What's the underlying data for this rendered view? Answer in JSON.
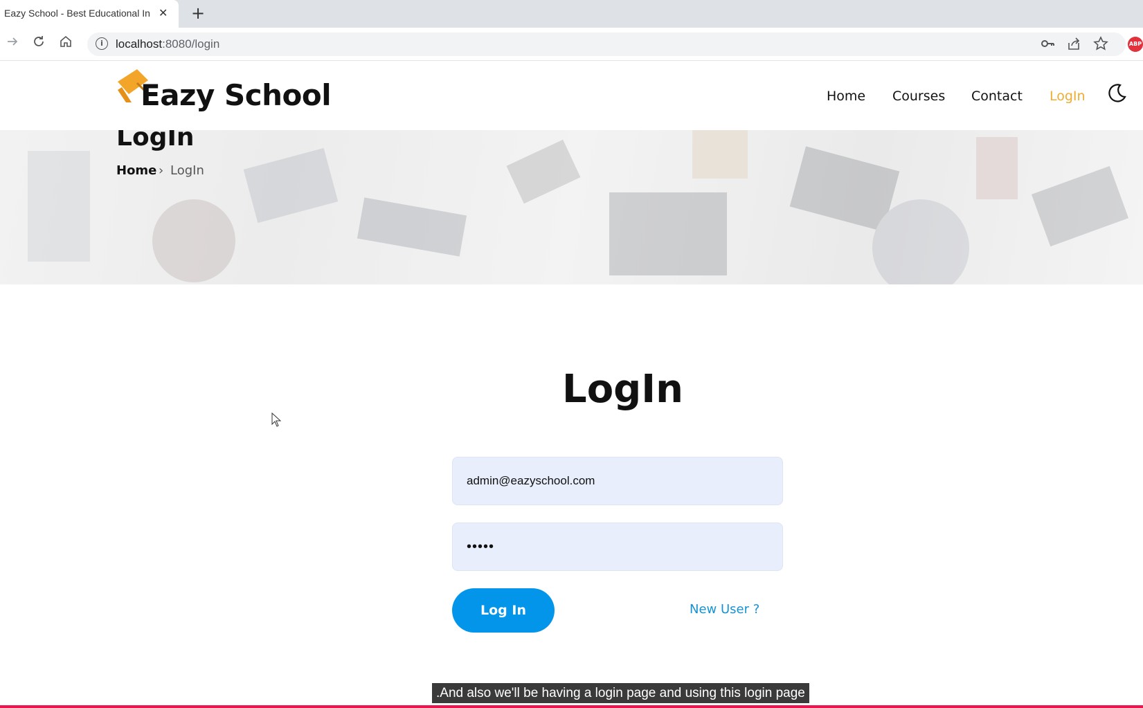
{
  "browser": {
    "tab_title": "Eazy School - Best Educational In",
    "tab_close": "✕",
    "new_tab": "+",
    "url_host": "localhost",
    "url_path": ":8080/login",
    "info_glyph": "i",
    "abp_label": "ABP",
    "icons": [
      "forward-icon",
      "reload-icon",
      "home-icon",
      "info-icon",
      "key-icon",
      "share-icon",
      "star-icon",
      "adblock-icon"
    ]
  },
  "header": {
    "brand": "Eazy School",
    "nav": [
      {
        "label": "Home",
        "active": false
      },
      {
        "label": "Courses",
        "active": false
      },
      {
        "label": "Contact",
        "active": false
      },
      {
        "label": "LogIn",
        "active": true
      }
    ],
    "accent_color": "#f0ac32"
  },
  "hero": {
    "title": "LogIn",
    "breadcrumb": {
      "home": "Home",
      "separator": "›",
      "current": "LogIn"
    }
  },
  "login": {
    "heading": "LogIn",
    "email_value": "admin@eazyschool.com",
    "password_mask": "•••••",
    "submit_label": "Log In",
    "new_user_label": "New User ?",
    "button_color": "#0295ea",
    "link_color": "#1592d1"
  },
  "caption": ".And also we'll be having a login page and using this login page"
}
